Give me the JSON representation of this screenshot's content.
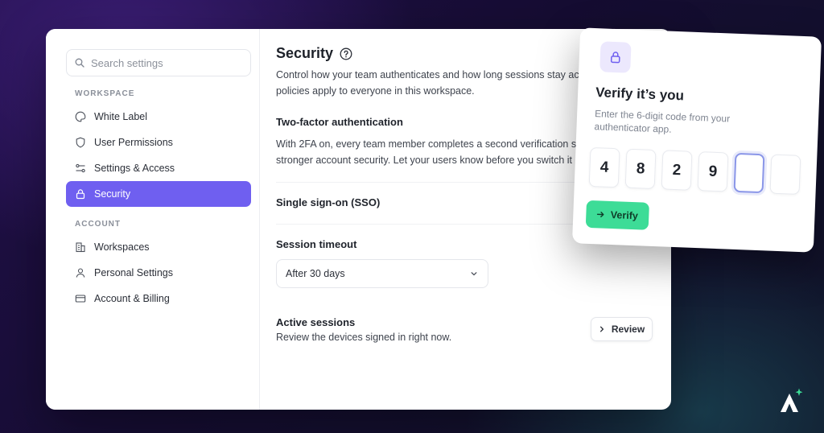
{
  "search": {
    "placeholder": "Search settings",
    "icon": "search-icon"
  },
  "sidebar": {
    "sections": [
      {
        "label": "WORKSPACE",
        "items": [
          {
            "label": "White Label",
            "icon": "palette-icon"
          },
          {
            "label": "User Permissions",
            "icon": "shield-icon"
          },
          {
            "label": "Settings & Access",
            "icon": "sliders-icon"
          },
          {
            "label": "Security",
            "icon": "lock-icon",
            "active": true
          }
        ]
      },
      {
        "label": "ACCOUNT",
        "items": [
          {
            "label": "Workspaces",
            "icon": "building-icon"
          },
          {
            "label": "Personal Settings",
            "icon": "user-icon"
          },
          {
            "label": "Account & Billing",
            "icon": "credit-card-icon"
          }
        ]
      }
    ]
  },
  "main": {
    "title": "Security",
    "title_icon": "help-circle-icon",
    "intro_line1": "Control how your team authenticates and how long sessions stay active.",
    "intro_line2": "policies apply to everyone in this workspace.",
    "twofa": {
      "heading": "Two-factor authentication",
      "line1": "With 2FA on, every team member completes a second verification step for",
      "line2": "stronger account security. Let your users know before you switch it on."
    },
    "sso": {
      "heading": "Single sign-on (SSO)"
    },
    "session": {
      "heading": "Session timeout",
      "selected": "After 30 days"
    },
    "active_sessions": {
      "heading": "Active sessions",
      "text": "Review the devices signed in right now.",
      "button": "Review"
    }
  },
  "modal": {
    "icon": "lock-icon",
    "title": "Verify it’s you",
    "subtitle": "Enter the 6-digit code from your authenticator app.",
    "digits": [
      "4",
      "8",
      "2",
      "9",
      "",
      ""
    ],
    "verify_label": "Verify"
  },
  "colors": {
    "accent": "#6f5ff0",
    "verify": "#3ddc97",
    "brand_mark": "#ffffff",
    "brand_spark": "#3ddc97"
  }
}
